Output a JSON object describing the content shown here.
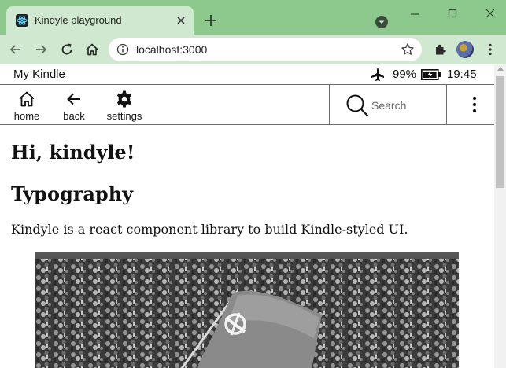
{
  "browser": {
    "tab_title": "Kindyle playground",
    "url": "localhost:3000"
  },
  "status_bar": {
    "device_name": "My Kindle",
    "battery_percent": "99%",
    "time": "19:45"
  },
  "toolbar": {
    "home_label": "home",
    "back_label": "back",
    "settings_label": "settings",
    "search_placeholder": "Search"
  },
  "content": {
    "greeting": "Hi, kindyle!",
    "section_title": "Typography",
    "intro": "Kindyle is a react component library to build Kindle-styled UI."
  },
  "colors": {
    "tabstrip": "#8dc88d",
    "toolbar": "#cfe8cf",
    "page_background": "#ffffff",
    "divider": "#6b6b6b"
  }
}
